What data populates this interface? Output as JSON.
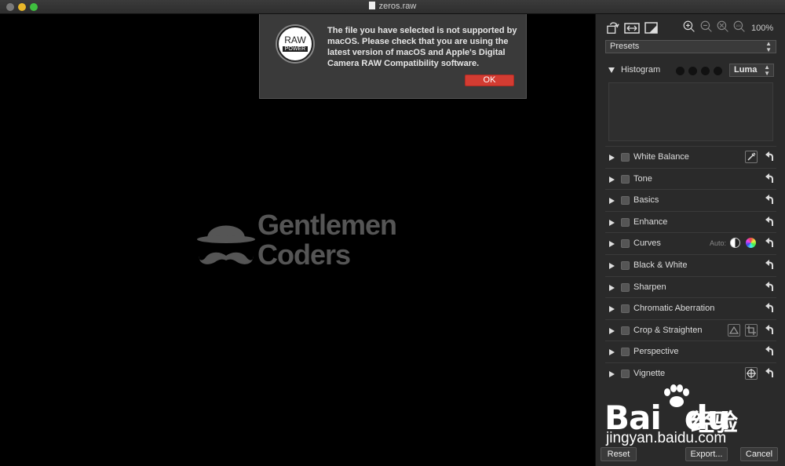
{
  "window": {
    "title": "zeros.raw"
  },
  "alert": {
    "logo_top": "RAW",
    "logo_bottom": "POWER",
    "message": "The file you have selected is not supported by macOS. Please check that you are using the latest version of macOS and Apple's Digital Camera RAW Compatibility software.",
    "ok_label": "OK"
  },
  "watermark": {
    "line1": "Gentlemen",
    "line2": "Coders"
  },
  "toolbar": {
    "zoom": "100%"
  },
  "presets": {
    "label": "Presets"
  },
  "histogram": {
    "label": "Histogram",
    "mode": "Luma"
  },
  "adjustments": [
    {
      "label": "White Balance"
    },
    {
      "label": "Tone"
    },
    {
      "label": "Basics"
    },
    {
      "label": "Enhance"
    },
    {
      "label": "Curves",
      "auto_label": "Auto:"
    },
    {
      "label": "Black & White"
    },
    {
      "label": "Sharpen"
    },
    {
      "label": "Chromatic Aberration"
    },
    {
      "label": "Crop & Straighten"
    },
    {
      "label": "Perspective"
    },
    {
      "label": "Vignette"
    }
  ],
  "buttons": {
    "reset": "Reset",
    "export": "Export...",
    "cancel": "Cancel"
  },
  "baidu": {
    "brand": "Bai",
    "brand2": "du",
    "cn": "经验",
    "url": "jingyan.baidu.com"
  },
  "colors": {
    "ok_button": "#d33c32",
    "panel": "#2a2a2a",
    "canvas": "#000000"
  }
}
